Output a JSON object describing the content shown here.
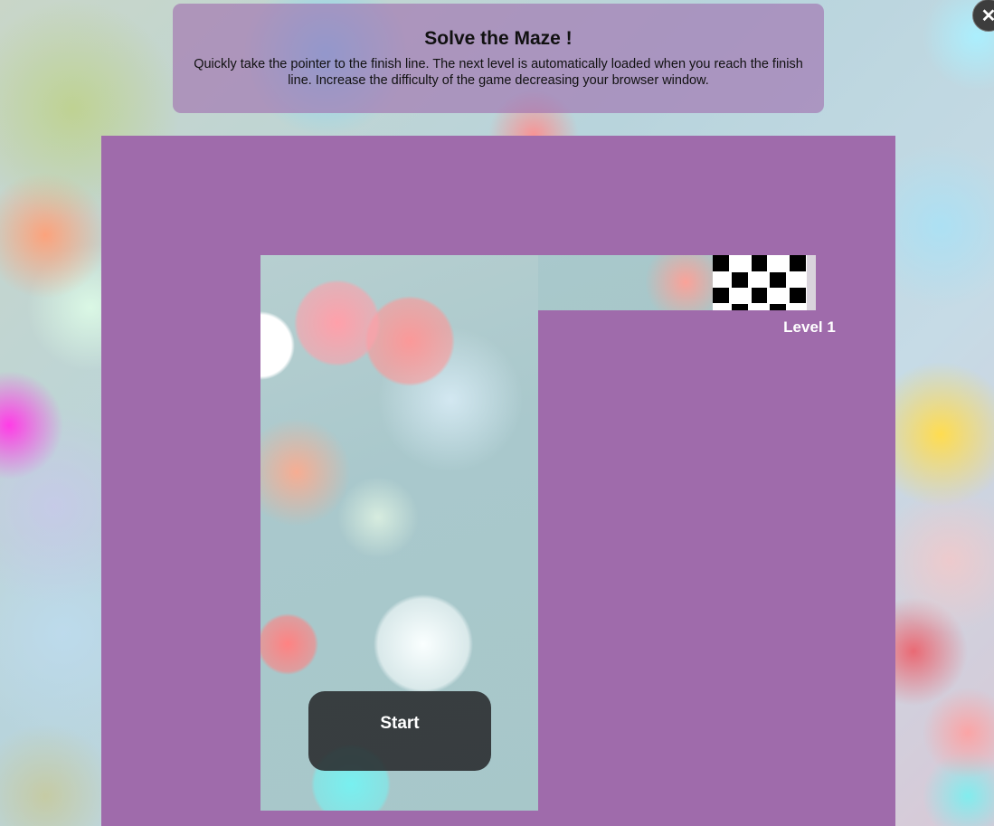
{
  "info": {
    "title": "Solve the Maze !",
    "text": "Quickly take the pointer to the finish line. The next level is automatically loaded when you reach the finish line. Increase the difficulty of the game decreasing your browser window.",
    "close_icon": "close-icon",
    "close_glyph": "✕"
  },
  "game": {
    "level_label": "Level 1",
    "start_label": "Start",
    "finish_icon": "checkered-flag-icon"
  },
  "colors": {
    "maze_wall": "#9f6bab",
    "panel_background": "rgba(160,110,175,0.62)",
    "start_button": "#2a2b2c",
    "close_button": "#3d3d3d"
  }
}
